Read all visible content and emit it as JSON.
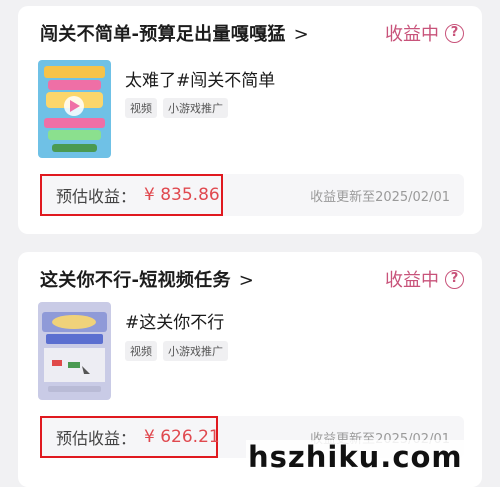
{
  "cards": [
    {
      "title": "闯关不简单-预算足出量嘎嘎猛",
      "chevron": "›",
      "status": "收益中",
      "help_icon": "?",
      "video_title": "太难了#闯关不简单",
      "tags": [
        "视频",
        "小游戏推广"
      ],
      "earnings_label": "预估收益：",
      "earnings_value": "¥ 835.86",
      "update_text": "收益更新至2025/02/01",
      "thumbnail_icon": "game-thumbnail-play-icon"
    },
    {
      "title": "这关你不行-短视频任务",
      "chevron": "›",
      "status": "收益中",
      "help_icon": "?",
      "video_title": "#这关你不行",
      "tags": [
        "视频",
        "小游戏推广"
      ],
      "earnings_label": "预估收益：",
      "earnings_value": "¥ 626.21",
      "update_text": "收益更新至2025/02/01",
      "thumbnail_icon": "game-thumbnail-icon"
    }
  ],
  "watermark": "hszhiku.com",
  "colors": {
    "accent": "#c8537a",
    "highlight_border": "#e0191f",
    "earnings": "#e0494f",
    "background": "#f1f1f3"
  }
}
